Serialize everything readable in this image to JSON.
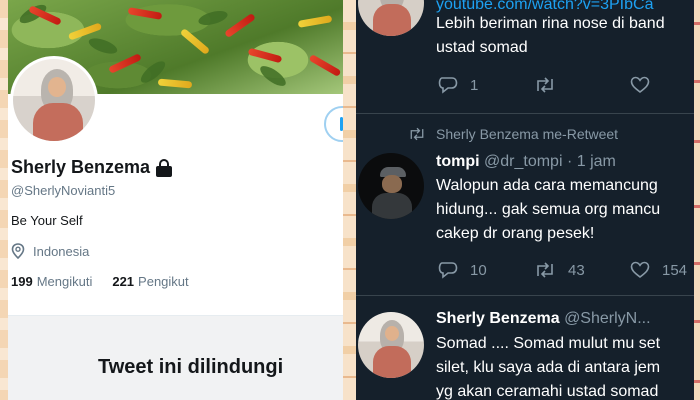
{
  "profile": {
    "display_name": "Sherly Benzema",
    "handle": "@SherlyNovianti5",
    "bio": "Be Your Self",
    "location": "Indonesia",
    "following_count": "199",
    "following_label": "Mengikuti",
    "followers_count": "221",
    "followers_label": "Pengikut",
    "protected_title": "Tweet ini dilindungi"
  },
  "timeline": {
    "tweet1": {
      "link": "youtube.com/watch?v=3PIbCa",
      "lines": [
        "Lebih beriman rina nose di band",
        "ustad somad"
      ],
      "replies": "1",
      "retweets": "",
      "likes": ""
    },
    "tweet2": {
      "retweet_note": "Sherly Benzema me-Retweet",
      "name": "tompi",
      "handle": "@dr_tompi",
      "time": "· 1 jam",
      "lines": [
        "Walopun ada cara memancung",
        "hidung... gak semua org mancu",
        "cakep dr orang pesek!"
      ],
      "replies": "10",
      "retweets": "43",
      "likes": "154"
    },
    "tweet3": {
      "name": "Sherly Benzema",
      "handle": "@SherlyN...",
      "lines": [
        "Somad .... Somad mulut mu set",
        "silet, klu saya ada di antara jem",
        "yg akan ceramahi ustad somad"
      ]
    }
  },
  "colors": {
    "accent": "#1da1f2",
    "timeline_bg": "#15202b",
    "muted": "#8899a6"
  }
}
